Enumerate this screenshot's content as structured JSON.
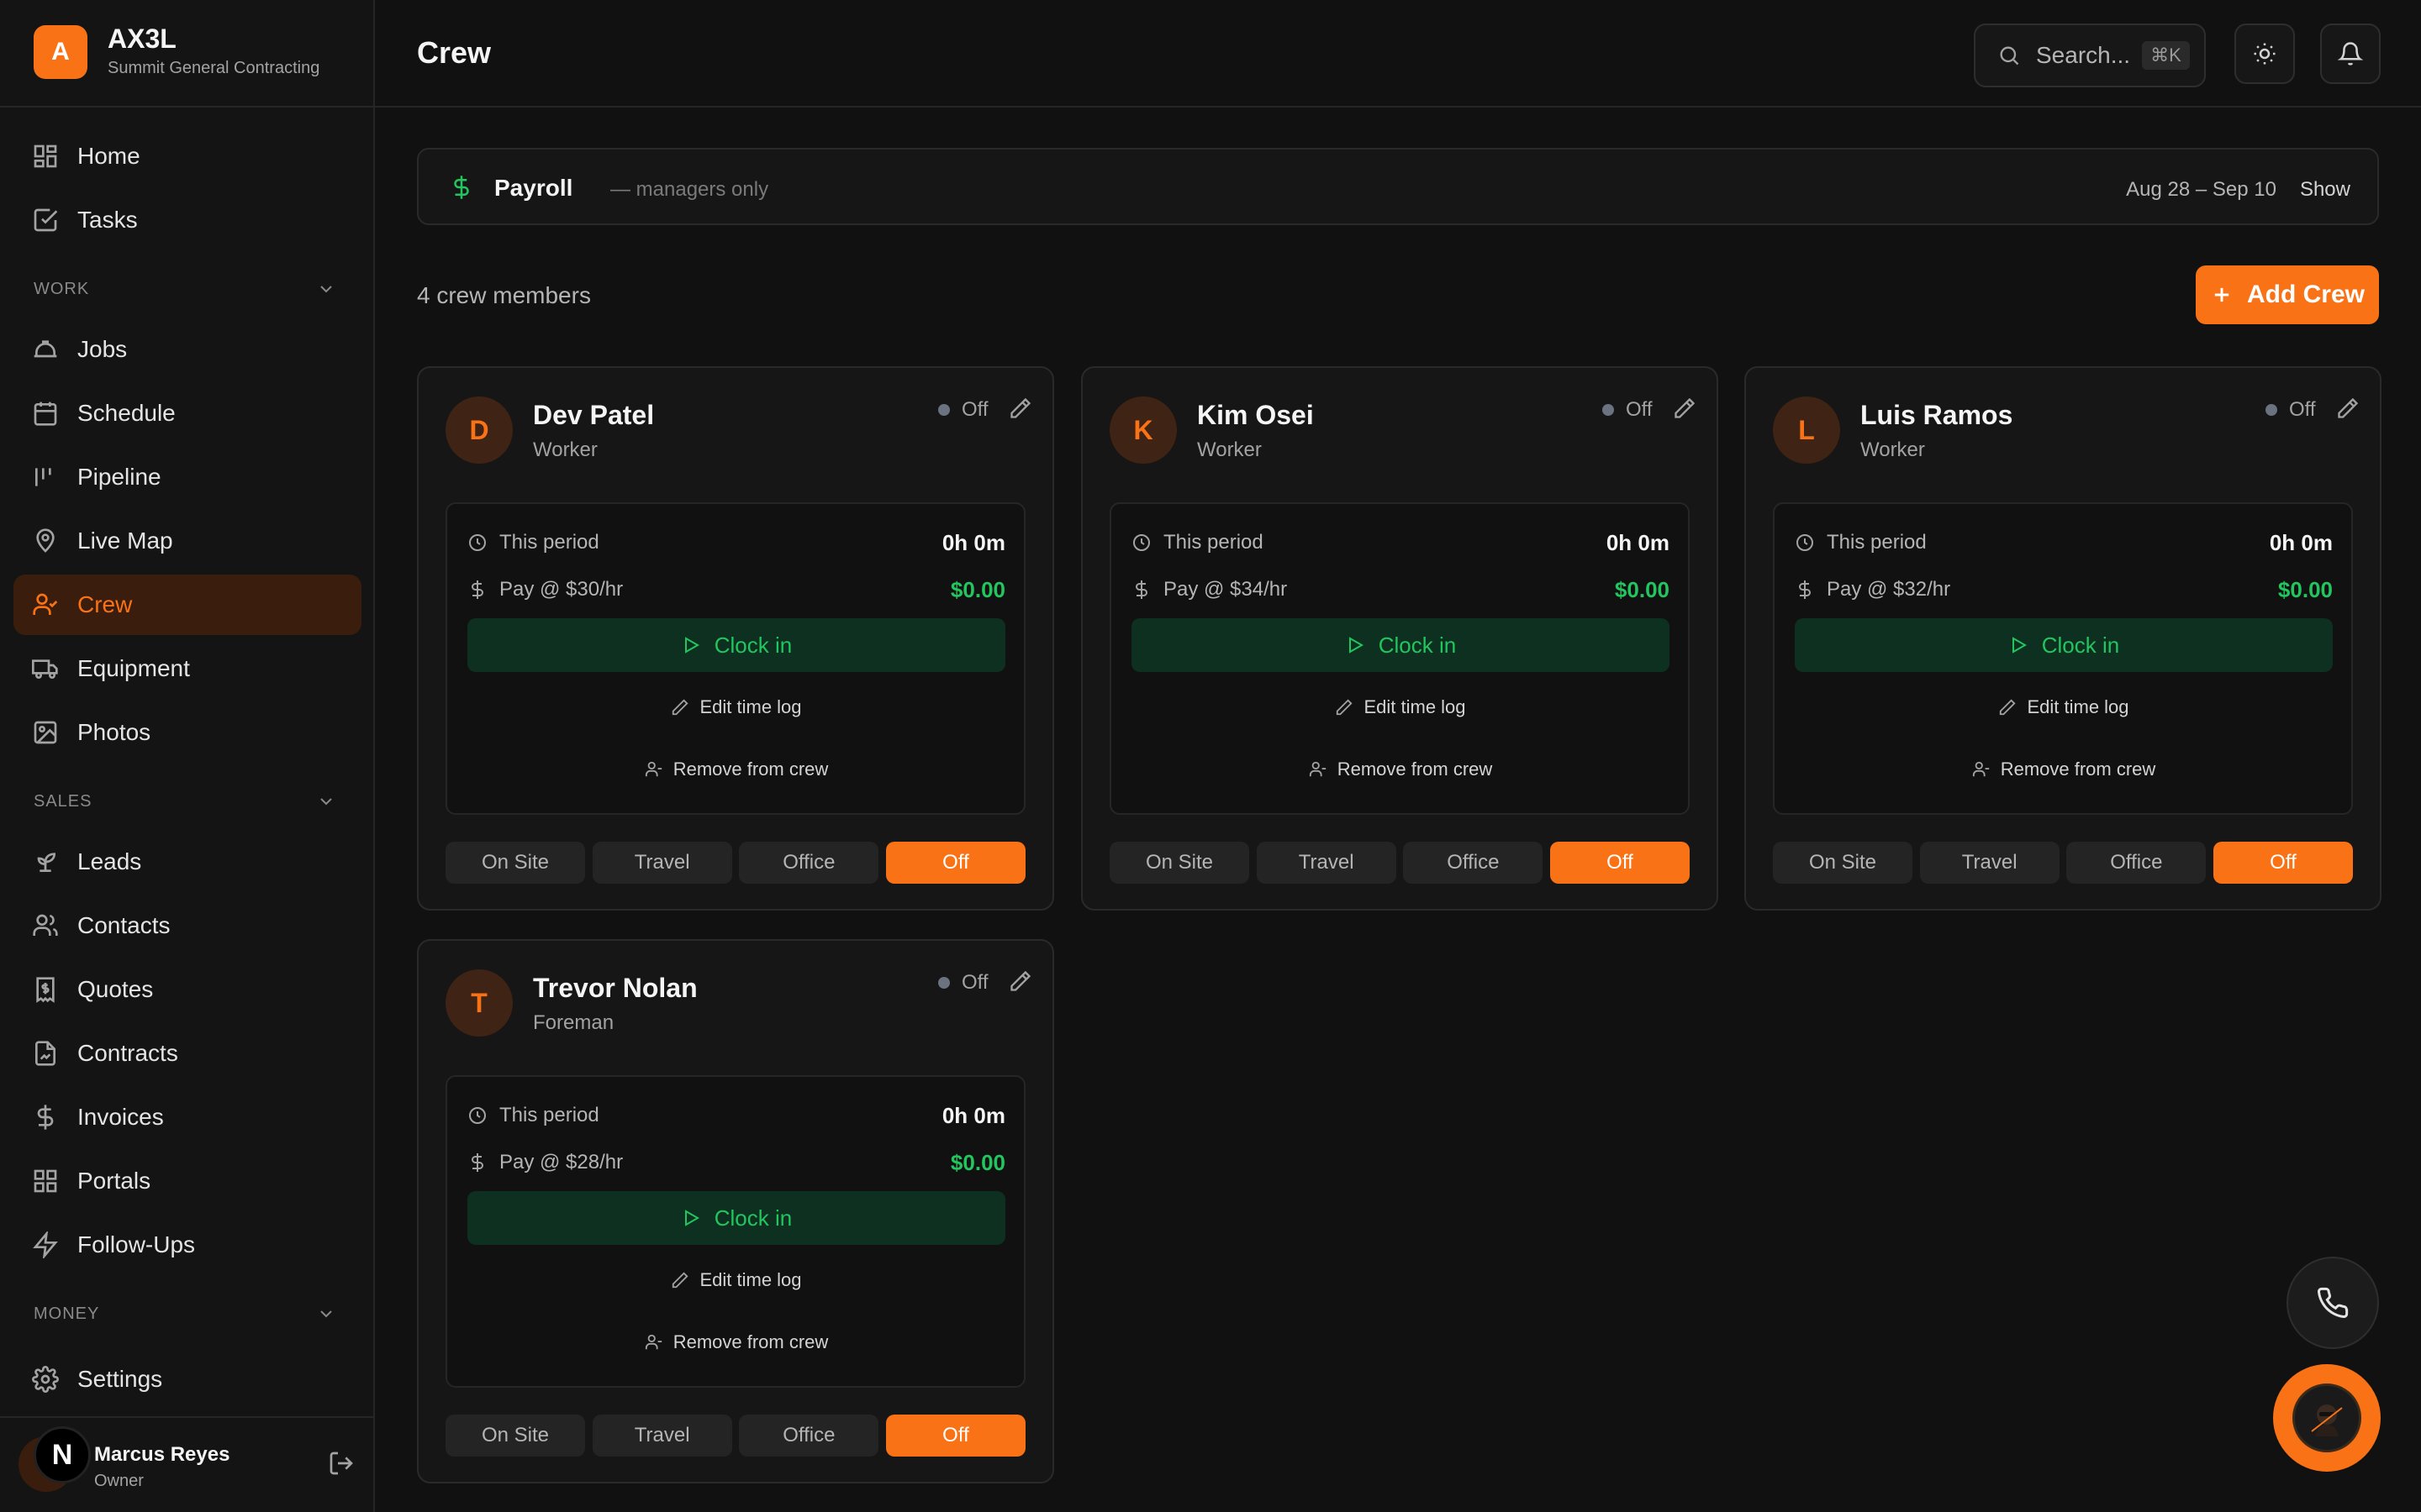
{
  "brand": {
    "logo_letter": "A",
    "name": "AX3L",
    "subtitle": "Summit General Contracting"
  },
  "nav": {
    "top": [
      {
        "label": "Home",
        "icon": "home-grid-icon"
      },
      {
        "label": "Tasks",
        "icon": "checkbox-icon"
      }
    ],
    "sections": [
      {
        "title": "WORK",
        "items": [
          {
            "label": "Jobs",
            "icon": "hardhat-icon"
          },
          {
            "label": "Schedule",
            "icon": "calendar-icon"
          },
          {
            "label": "Pipeline",
            "icon": "pipeline-icon"
          },
          {
            "label": "Live Map",
            "icon": "map-pin-icon"
          },
          {
            "label": "Crew",
            "icon": "user-check-icon",
            "active": true
          },
          {
            "label": "Equipment",
            "icon": "truck-icon"
          },
          {
            "label": "Photos",
            "icon": "image-icon"
          }
        ]
      },
      {
        "title": "SALES",
        "items": [
          {
            "label": "Leads",
            "icon": "sprout-icon"
          },
          {
            "label": "Contacts",
            "icon": "users-icon"
          },
          {
            "label": "Quotes",
            "icon": "receipt-icon"
          },
          {
            "label": "Contracts",
            "icon": "file-signature-icon"
          },
          {
            "label": "Invoices",
            "icon": "dollar-icon"
          },
          {
            "label": "Portals",
            "icon": "grid-icon"
          },
          {
            "label": "Follow-Ups",
            "icon": "zap-icon"
          }
        ]
      },
      {
        "title": "MONEY",
        "items": []
      }
    ],
    "settings": "Settings"
  },
  "user": {
    "initial": "N",
    "name": "Marcus Reyes",
    "role": "Owner"
  },
  "header": {
    "title": "Crew",
    "search_placeholder": "Search...",
    "search_shortcut": "⌘K"
  },
  "payroll": {
    "title": "Payroll",
    "note": "— managers only",
    "range": "Aug 28 – Sep 10",
    "toggle": "Show"
  },
  "crew": {
    "count_label": "4 crew members",
    "add_label": "Add Crew",
    "labels": {
      "period": "This period",
      "clock_in": "Clock in",
      "edit_log": "Edit time log",
      "remove": "Remove from crew",
      "modes": [
        "On Site",
        "Travel",
        "Office",
        "Off"
      ]
    },
    "members": [
      {
        "initial": "D",
        "name": "Dev Patel",
        "role": "Worker",
        "status": "Off",
        "hours": "0h 0m",
        "rate": "Pay @ $30/hr",
        "pay": "$0.00",
        "mode": "Off"
      },
      {
        "initial": "K",
        "name": "Kim Osei",
        "role": "Worker",
        "status": "Off",
        "hours": "0h 0m",
        "rate": "Pay @ $34/hr",
        "pay": "$0.00",
        "mode": "Off"
      },
      {
        "initial": "L",
        "name": "Luis Ramos",
        "role": "Worker",
        "status": "Off",
        "hours": "0h 0m",
        "rate": "Pay @ $32/hr",
        "pay": "$0.00",
        "mode": "Off"
      },
      {
        "initial": "T",
        "name": "Trevor Nolan",
        "role": "Foreman",
        "status": "Off",
        "hours": "0h 0m",
        "rate": "Pay @ $28/hr",
        "pay": "$0.00",
        "mode": "Off"
      }
    ]
  },
  "colors": {
    "accent": "#f97316",
    "success": "#22c55e",
    "background": "#111111",
    "surface": "#161616"
  }
}
